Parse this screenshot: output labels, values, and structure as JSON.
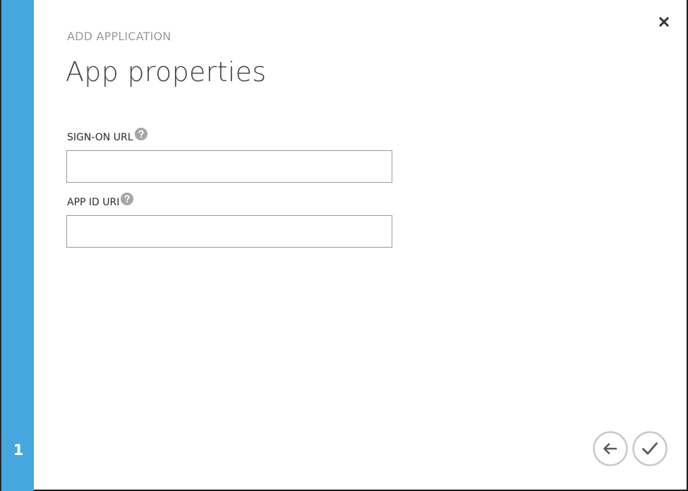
{
  "dialog": {
    "kicker": "ADD APPLICATION",
    "title": "App properties",
    "step": "1",
    "accent_color": "#45a7dd"
  },
  "fields": {
    "sign_on_url": {
      "label": "SIGN-ON URL",
      "value": "",
      "help_icon": "question-circle-icon"
    },
    "app_id_uri": {
      "label": "APP ID URI",
      "value": "",
      "help_icon": "question-circle-icon"
    }
  },
  "actions": {
    "close_icon": "close-icon",
    "back_icon": "arrow-left-icon",
    "complete_icon": "checkmark-icon"
  }
}
